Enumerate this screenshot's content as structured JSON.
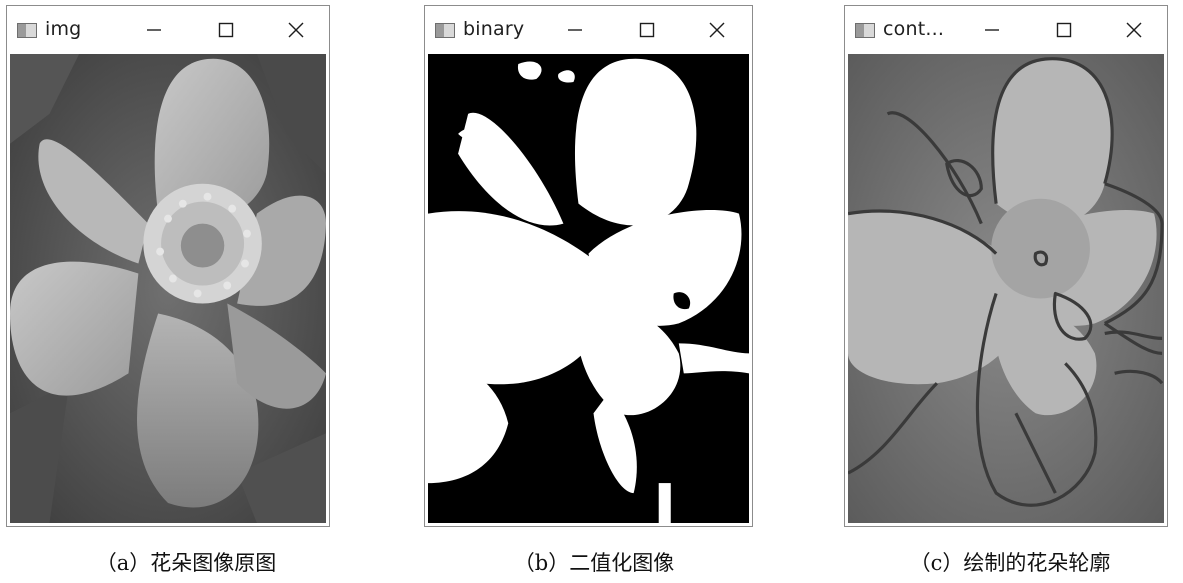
{
  "windows": [
    {
      "title": "img",
      "icon": "window-app-icon",
      "controls": {
        "minimize": "—",
        "maximize": "☐",
        "close": "✕"
      },
      "content": "grayscale flower image"
    },
    {
      "title": "binary",
      "icon": "window-app-icon",
      "controls": {
        "minimize": "—",
        "maximize": "☐",
        "close": "✕"
      },
      "content": "binary thresholded flower image"
    },
    {
      "title": "cont...",
      "icon": "window-app-icon",
      "controls": {
        "minimize": "—",
        "maximize": "☐",
        "close": "✕"
      },
      "content": "flower image with drawn contours"
    }
  ],
  "captions": {
    "a": "（a）花朵图像原图",
    "b": "（b）二值化图像",
    "c": "（c）绘制的花朵轮廓"
  },
  "colors": {
    "window_border": "#8c8c8c",
    "title_text": "#202020",
    "contour": "#3a3a3a"
  }
}
